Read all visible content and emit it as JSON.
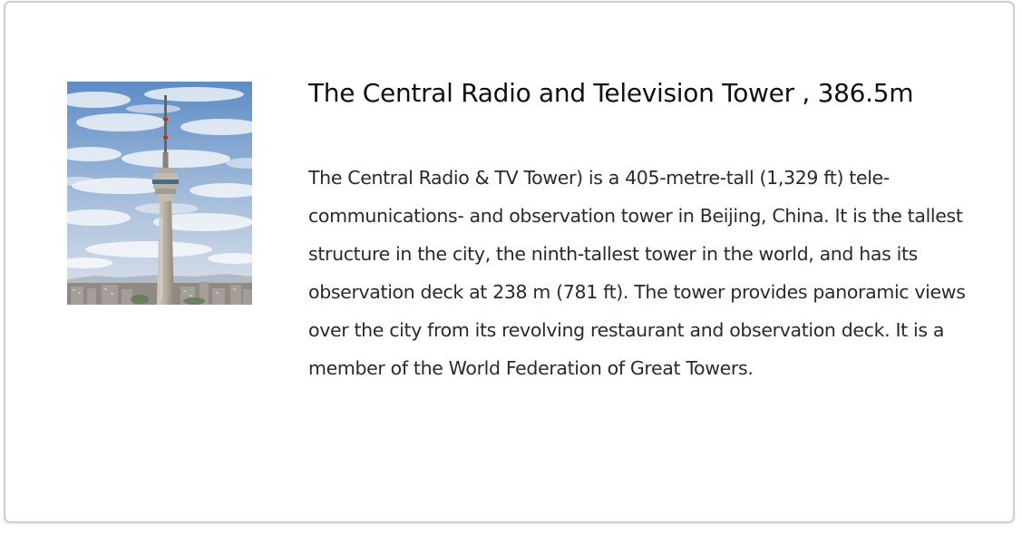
{
  "card": {
    "title": "The Central Radio and Television Tower , 386.5m",
    "description": "The Central Radio & TV Tower) is a 405-metre-tall (1,329 ft) tele-communications- and observation tower in Beijing, China. It is the tallest structure in the city, the ninth-tallest tower in the world, and has its observation deck at 238 m (781 ft). The tower provides panoramic views over the city from its revolving restaurant and observation deck. It is a member of the World Federation of Great Towers."
  },
  "image": {
    "subject": "tower-photo",
    "colors": {
      "sky_top": "#5f8fc9",
      "sky_bottom": "#d6dde6",
      "cloud": "#ffffff",
      "tower": "#b9b2a6",
      "city": "#8d8680"
    }
  }
}
